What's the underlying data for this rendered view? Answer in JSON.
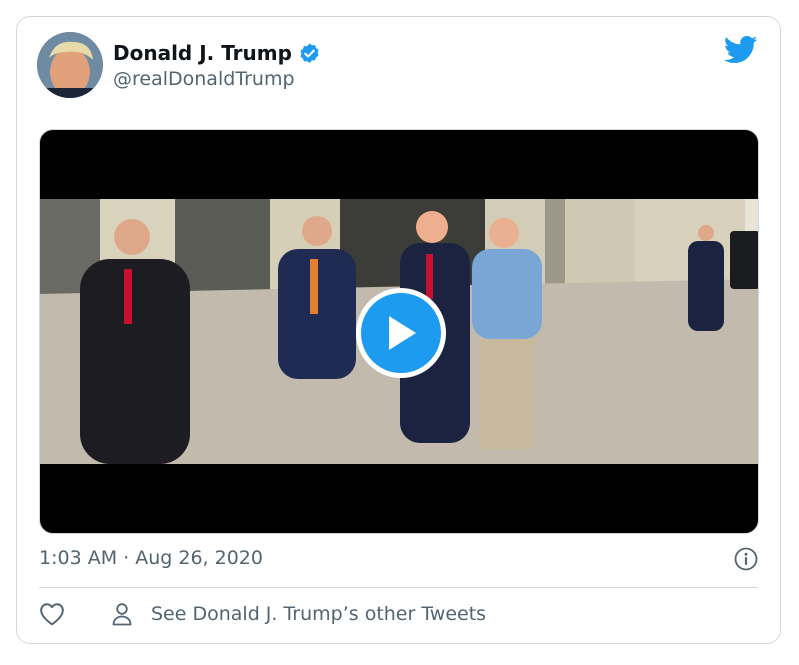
{
  "tweet": {
    "author_name": "Donald J. Trump",
    "author_handle": "@realDonaldTrump",
    "timestamp": "1:03 AM · Aug 26, 2020",
    "other_tweets_label": "See Donald J. Trump’s other Tweets"
  },
  "icons": {
    "verified": "verified-badge-icon",
    "brand": "twitter-bird-icon",
    "play": "play-icon",
    "info": "info-icon",
    "like": "heart-icon",
    "profile": "person-icon"
  },
  "colors": {
    "accent": "#1d9bf0",
    "text": "#0f1419",
    "secondary_text": "#536471",
    "border": "#cfd9de"
  }
}
